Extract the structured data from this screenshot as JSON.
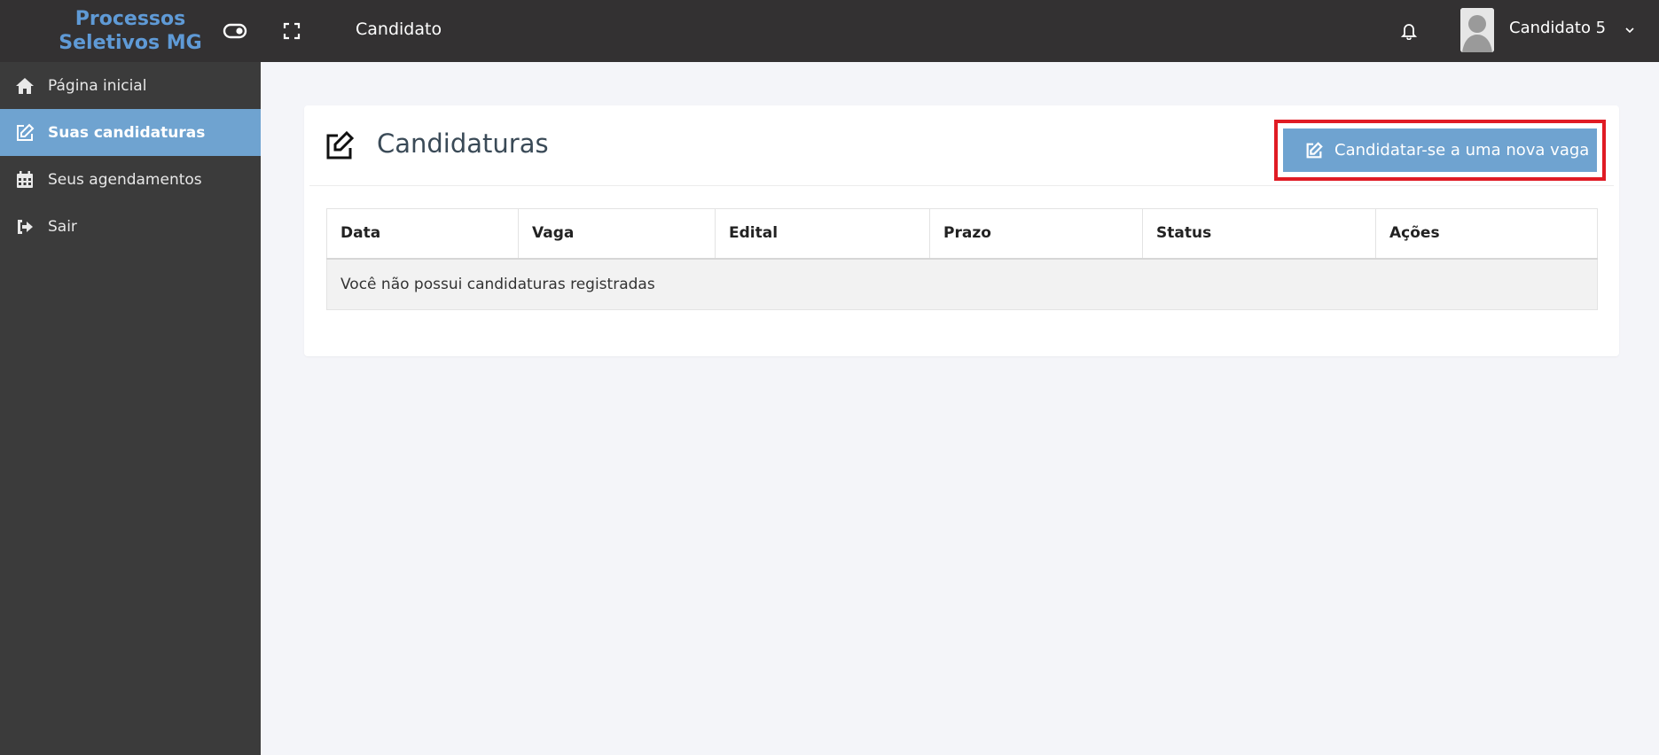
{
  "brand": {
    "line1": "Processos",
    "line2": "Seletivos MG"
  },
  "topbar": {
    "toggle_icon": "toggle-icon",
    "fullscreen_icon": "fullscreen-icon",
    "role": "Candidato",
    "bell_icon": "bell-icon",
    "user_name": "Candidato 5",
    "chevron_icon": "chevron-down-icon"
  },
  "sidebar": {
    "items": [
      {
        "label": "Página inicial",
        "icon": "home-icon",
        "active": false
      },
      {
        "label": "Suas candidaturas",
        "icon": "edit-icon",
        "active": true
      },
      {
        "label": "Seus agendamentos",
        "icon": "calendar-icon",
        "active": false
      },
      {
        "label": "Sair",
        "icon": "sign-out-icon",
        "active": false
      }
    ]
  },
  "main": {
    "title": "Candidaturas",
    "title_icon": "edit-icon",
    "new_button_label": "Candidatar-se a uma nova vaga",
    "table": {
      "headers": [
        "Data",
        "Vaga",
        "Edital",
        "Prazo",
        "Status",
        "Ações"
      ],
      "empty_message": "Você não possui candidaturas registradas"
    }
  },
  "colors": {
    "topbar": "#333132",
    "sidebar": "#3b3b3b",
    "accent": "#6fa3d0",
    "brand_text": "#5f9ad6",
    "highlight": "#e01b24",
    "background": "#f4f5f9"
  }
}
